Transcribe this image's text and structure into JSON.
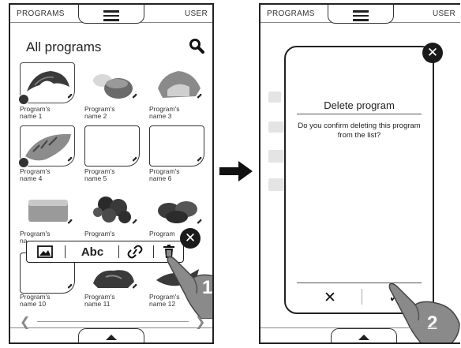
{
  "left_screen": {
    "topbar": {
      "left_label": "PROGRAMS",
      "right_label": "USER",
      "menu_icon": "hamburger-menu-icon"
    },
    "title": "All programs",
    "search_icon": "magnifier-icon",
    "programs": [
      {
        "name": "Program's\nname 1",
        "image": "croissant"
      },
      {
        "name": "Program's\nname 2",
        "image": "bread-roll"
      },
      {
        "name": "Program's\nname 3",
        "image": "bread-slice"
      },
      {
        "name": "Program's\nname 4",
        "image": "baguette"
      },
      {
        "name": "Program's\nname 5",
        "image": "empty"
      },
      {
        "name": "Program's\nname 6",
        "image": "empty"
      },
      {
        "name": "Program's\nna",
        "image": "cake"
      },
      {
        "name": "Program's",
        "image": "pastries"
      },
      {
        "name": "Program",
        "image": "burgers"
      },
      {
        "name": "Program's\nname 10",
        "image": "empty"
      },
      {
        "name": "Program's\nname 11",
        "image": "meat"
      },
      {
        "name": "Program's\nname 12",
        "image": "fish"
      }
    ],
    "toolbar": {
      "image_icon": "image-icon",
      "text_label": "Abc",
      "link_icon": "link-icon",
      "delete_icon": "trash-icon",
      "close_label": "✕"
    },
    "step_number": "1"
  },
  "right_screen": {
    "topbar": {
      "left_label": "PROGRAMS",
      "right_label": "USER",
      "menu_icon": "hamburger-menu-icon"
    },
    "dialog": {
      "title": "Delete program",
      "message": "Do you confirm deleting this program from the list?",
      "cancel_label": "✕",
      "confirm_label": "✓",
      "close_label": "✕"
    },
    "step_number": "2"
  }
}
